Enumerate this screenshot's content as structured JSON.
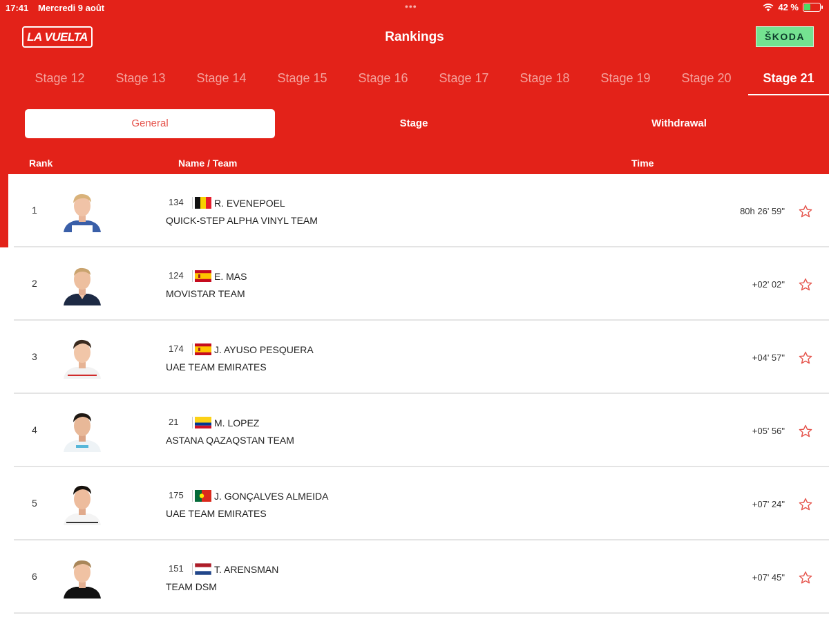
{
  "status_bar": {
    "time": "17:41",
    "date": "Mercredi 9 août",
    "dots": "•••",
    "battery": "42 %",
    "battery_level": 0.42
  },
  "header": {
    "logo": "LA VUELTA",
    "title": "Rankings",
    "sponsor": "ŠKODA"
  },
  "stages": [
    "Stage 12",
    "Stage 13",
    "Stage 14",
    "Stage 15",
    "Stage 16",
    "Stage 17",
    "Stage 18",
    "Stage 19",
    "Stage 20",
    "Stage 21"
  ],
  "active_stage": "Stage 21",
  "segments": [
    "General",
    "Stage",
    "Withdrawal"
  ],
  "active_segment": "General",
  "columns": {
    "rank": "Rank",
    "name_team": "Name / Team",
    "time": "Time"
  },
  "colors": {
    "brand_red": "#e32219",
    "active_segment_text": "#e5534b",
    "inactive_tab": "#f4a39d",
    "sponsor_green": "#74e291"
  },
  "rankings": [
    {
      "rank": "1",
      "bib": "134",
      "flag": "belgium-flag",
      "rider": "R. EVENEPOEL",
      "team": "QUICK-STEP ALPHA VINYL TEAM",
      "time": "80h 26' 59\""
    },
    {
      "rank": "2",
      "bib": "124",
      "flag": "spain-flag",
      "rider": "E. MAS",
      "team": "MOVISTAR TEAM",
      "time": "+02' 02\""
    },
    {
      "rank": "3",
      "bib": "174",
      "flag": "spain-flag",
      "rider": "J. AYUSO PESQUERA",
      "team": "UAE TEAM EMIRATES",
      "time": "+04' 57\""
    },
    {
      "rank": "4",
      "bib": "21",
      "flag": "colombia-flag",
      "rider": "M. LOPEZ",
      "team": "ASTANA QAZAQSTAN TEAM",
      "time": "+05' 56\""
    },
    {
      "rank": "5",
      "bib": "175",
      "flag": "portugal-flag",
      "rider": "J. GONÇALVES ALMEIDA",
      "team": "UAE TEAM EMIRATES",
      "time": "+07' 24\""
    },
    {
      "rank": "6",
      "bib": "151",
      "flag": "netherlands-flag",
      "rider": "T. ARENSMAN",
      "team": "TEAM DSM",
      "time": "+07' 45\""
    }
  ]
}
